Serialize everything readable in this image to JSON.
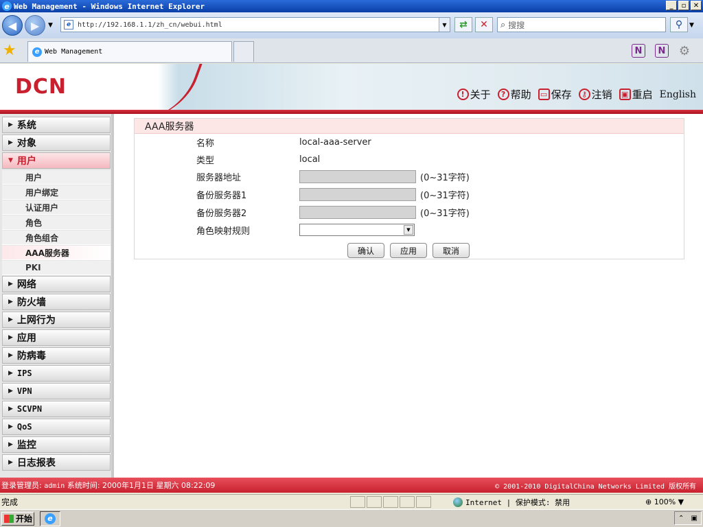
{
  "window": {
    "title": "Web Management - Windows Internet Explorer",
    "min_glyph": "_",
    "max_glyph": "▫",
    "close_glyph": "✕"
  },
  "browser": {
    "url": "http://192.168.1.1/zh_cn/webui.html",
    "search_placeholder": "搜搜",
    "tab_title": "Web Management"
  },
  "header": {
    "logo": "DCN",
    "links": {
      "about": "关于",
      "help": "帮助",
      "save": "保存",
      "logout": "注销",
      "restart": "重启",
      "english": "English"
    }
  },
  "sidebar": {
    "system": "系统",
    "object": "对象",
    "user": "用户",
    "user_sub": {
      "users": "用户",
      "binding": "用户绑定",
      "auth_users": "认证用户",
      "roles": "角色",
      "role_groups": "角色组合",
      "aaa": "AAA服务器",
      "pki": "PKI"
    },
    "network": "网络",
    "firewall": "防火墙",
    "behavior": "上网行为",
    "application": "应用",
    "antivirus": "防病毒",
    "ips": "IPS",
    "vpn": "VPN",
    "scvpn": "SCVPN",
    "qos": "QoS",
    "monitor": "监控",
    "log": "日志报表"
  },
  "panel": {
    "title": "AAA服务器",
    "name_label": "名称",
    "name_value": "local-aaa-server",
    "type_label": "类型",
    "type_value": "local",
    "server_label": "服务器地址",
    "server_value": "",
    "server_hint": "(0~31字符)",
    "backup1_label": "备份服务器1",
    "backup1_value": "",
    "backup1_hint": "(0~31字符)",
    "backup2_label": "备份服务器2",
    "backup2_value": "",
    "backup2_hint": "(0~31字符)",
    "role_map_label": "角色映射规则",
    "role_map_value": "",
    "confirm": "确认",
    "apply": "应用",
    "cancel": "取消"
  },
  "footer": {
    "login_label": "登录管理员:",
    "login_user": "admin",
    "time_label": "系统时间:",
    "time_value": "2000年1月1日 星期六 08:22:09",
    "copyright": "© 2001-2010 DigitalChina Networks Limited 版权所有"
  },
  "statusbar": {
    "status": "完成",
    "zone": "Internet | 保护模式: 禁用",
    "zoom": "100%"
  },
  "taskbar": {
    "start": "开始"
  },
  "colors": {
    "brand_red": "#c8202f",
    "panel_header": "#fde6e6"
  }
}
